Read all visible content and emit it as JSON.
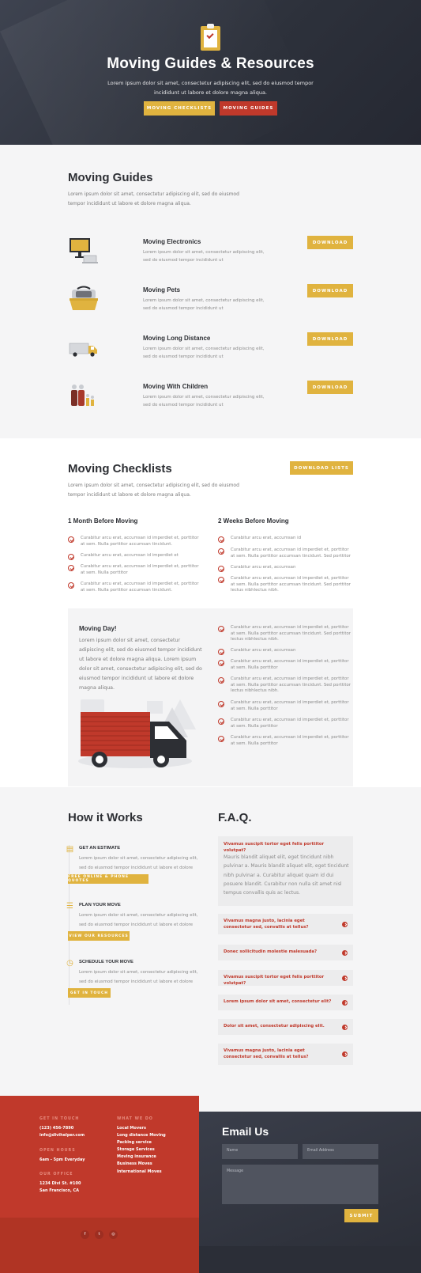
{
  "hero": {
    "title": "Moving Guides & Resources",
    "text": "Lorem ipsum dolor sit amet, consectetur adipiscing elit, sed do eiusmod tempor incididunt ut labore et dolore magna aliqua.",
    "btn_checklists": "Moving Checklists",
    "btn_guides": "Moving Guides"
  },
  "guides": {
    "title": "Moving Guides",
    "text": "Lorem ipsum dolor sit amet, consectetur adipiscing elit, sed do eiusmod tempor incididunt ut labore et dolore magna aliqua.",
    "items": [
      {
        "title": "Moving Electronics",
        "text": "Lorem ipsum dolor sit amet, consectetur adipiscing elit, sed do eiusmod tempor incididunt ut",
        "button": "Download",
        "icon": "computer-icon"
      },
      {
        "title": "Moving Pets",
        "text": "Lorem ipsum dolor sit amet, consectetur adipiscing elit, sed do eiusmod tempor incididunt ut",
        "button": "Download",
        "icon": "pet-carrier-icon"
      },
      {
        "title": "Moving Long Distance",
        "text": "Lorem ipsum dolor sit amet, consectetur adipiscing elit, sed do eiusmod tempor incididunt ut",
        "button": "Download",
        "icon": "truck-icon"
      },
      {
        "title": "Moving With Children",
        "text": "Lorem ipsum dolor sit amet, consectetur adipiscing elit, sed do eiusmod tempor incididunt ut",
        "button": "Download",
        "icon": "family-icon"
      }
    ]
  },
  "checklists": {
    "title": "Moving Checklists",
    "text": "Lorem ipsum dolor sit amet, consectetur adipiscing elit, sed do eiusmod tempor incididunt ut labore et dolore magna aliqua.",
    "button": "Download Lists",
    "col1_title": "1 Month Before Moving",
    "col1_items": [
      "Curabitur arcu erat, accumsan id imperdiet et, porttitor at sem. Nulla porttitor accumsan tincidunt.",
      "Curabitur arcu erat, accumsan id imperdiet et",
      "Curabitur arcu erat, accumsan id imperdiet et, porttitor at sem. Nulla porttitor",
      "Curabitur arcu erat, accumsan id imperdiet et, porttitor at sem. Nulla porttitor accumsan tincidunt."
    ],
    "col2_title": "2 Weeks Before Moving",
    "col2_items": [
      "Curabitur arcu erat, accumsan id",
      "Curabitur arcu erat, accumsan id imperdiet et, porttitor at sem. Nulla porttitor accumsan tincidunt. Sed porttitor",
      "Curabitur arcu erat, accumsan",
      "Curabitur arcu erat, accumsan id imperdiet et, porttitor at sem. Nulla porttitor accumsan tincidunt. Sed porttitor lectus nibhlectus nibh."
    ],
    "moving_day_title": "Moving Day!",
    "moving_day_text": "Lorem ipsum dolor sit amet, consectetur adipiscing elit, sed do eiusmod tempor incididunt ut labore et dolore magna aliqua. Lorem ipsum dolor sit amet, consectetur adipiscing elit, sed do eiusmod tempor incididunt ut labore et dolore magna aliqua.",
    "moving_day_items": [
      "Curabitur arcu erat, accumsan id imperdiet et, porttitor at sem. Nulla porttitor accumsan tincidunt. Sed porttitor lectus nibhlectus nibh.",
      "Curabitur arcu erat, accumsan",
      "Curabitur arcu erat, accumsan id imperdiet et, porttitor at sem. Nulla porttitor",
      "Curabitur arcu erat, accumsan id imperdiet et, porttitor at sem. Nulla porttitor accumsan tincidunt. Sed porttitor lectus nibhlectus nibh.",
      "Curabitur arcu erat, accumsan id imperdiet et, porttitor at sem. Nulla porttitor",
      "Curabitur arcu erat, accumsan id imperdiet et, porttitor at sem. Nulla porttitor",
      "Curabitur arcu erat, accumsan id imperdiet et, porttitor at sem. Nulla porttitor"
    ]
  },
  "how": {
    "title": "How it Works",
    "steps": [
      {
        "title": "Get an Estimate",
        "text": "Lorem ipsum dolor sit amet, consectetur adipiscing elit, sed do eiusmod tempor incididunt ut labore et dolore",
        "button": "Free Online & Phone Quotes",
        "icon": "document-icon"
      },
      {
        "title": "Plan Your Move",
        "text": "Lorem ipsum dolor sit amet, consectetur adipiscing elit, sed do eiusmod tempor incididunt ut labore et dolore",
        "button": "View Our Resources",
        "icon": "list-icon"
      },
      {
        "title": "Schedule Your Move",
        "text": "Lorem ipsum dolor sit amet, consectetur adipiscing elit, sed do eiusmod tempor incididunt ut labore et dolore",
        "button": "Get in Touch",
        "icon": "clock-icon"
      }
    ]
  },
  "faq": {
    "title": "F.A.Q.",
    "open_question": "Vivamus suscipit tortor eget felis porttitor volutpat?",
    "open_answer": "Mauris blandit aliquet elit, eget tincidunt nibh pulvinar a. Mauris blandit aliquet elit, eget tincidunt nibh pulvinar a. Curabitur aliquet quam id dui posuere blandit. Curabitur non nulla sit amet nisl tempus convallis quis ac lectus.",
    "items": [
      "Vivamus magna justo, lacinia eget consectetur sed, convallis at tellus?",
      "Donec sollicitudin molestie malesuada?",
      "Vivamus suscipit tortor eget felis porttitor volutpat?",
      "Lorem ipsum dolor sit amet, consectetur elit?",
      "Dolor sit amet, consectetur adipiscing elit.",
      "Vivamus magna justo, lacinia eget consectetur sed, convallis at tellus?"
    ]
  },
  "footer": {
    "contact_head": "Get in Touch",
    "phone": "(123) 456-7890",
    "email": "info@divihelper.com",
    "hours_head": "Open Hours",
    "hours": "6am - 5pm Everyday",
    "office_head": "Our Office",
    "address1": "1234 Divi St. #100",
    "address2": "San Francisco, CA",
    "what_head": "What We Do",
    "services": [
      "Local Movers",
      "Long distance Moving",
      "Packing service",
      "Storage Services",
      "Moving insurance",
      "Business Moves",
      "International Moves"
    ],
    "social": [
      {
        "icon": "facebook-icon",
        "glyph": "f"
      },
      {
        "icon": "twitter-icon",
        "glyph": "t"
      },
      {
        "icon": "instagram-icon",
        "glyph": "◎"
      }
    ],
    "email_title": "Email Us",
    "name_placeholder": "Name",
    "email_placeholder": "Email Address",
    "message_placeholder": "Message",
    "submit": "Submit"
  },
  "colors": {
    "gold": "#e0b33f",
    "red": "#c0392b",
    "dark": "#2d313b"
  }
}
